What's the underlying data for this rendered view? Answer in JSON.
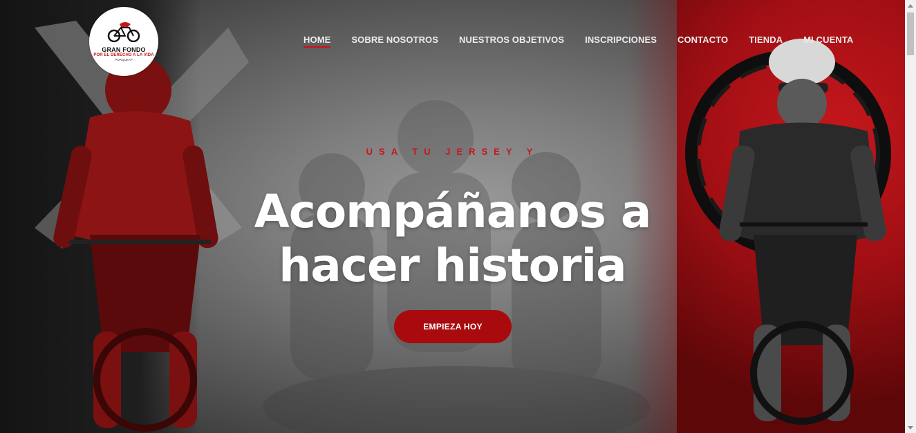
{
  "logo": {
    "title": "GRAN FONDO",
    "subtitle": "POR EL DERECHO A LA VIDA",
    "tagline": "PORQUEAP",
    "icon": "cyclist-logo-icon",
    "accent": "#c4171c"
  },
  "nav": {
    "items": [
      {
        "label": "HOME",
        "active": true
      },
      {
        "label": "SOBRE NOSOTROS",
        "active": false
      },
      {
        "label": "NUESTROS OBJETIVOS",
        "active": false
      },
      {
        "label": "INSCRIPCIONES",
        "active": false
      },
      {
        "label": "CONTACTO",
        "active": false
      },
      {
        "label": "TIENDA",
        "active": false
      },
      {
        "label": "MI CUENTA",
        "active": false
      }
    ]
  },
  "hero": {
    "eyebrow": "USA TU JERSEY Y",
    "headline_line1": "Acompáñanos a",
    "headline_line2": "hacer historia",
    "cta_label": "EMPIEZA HOY",
    "colors": {
      "brand_red": "#a80a0d",
      "eyebrow_red": "#c4171c",
      "headline": "#ffffff"
    }
  }
}
